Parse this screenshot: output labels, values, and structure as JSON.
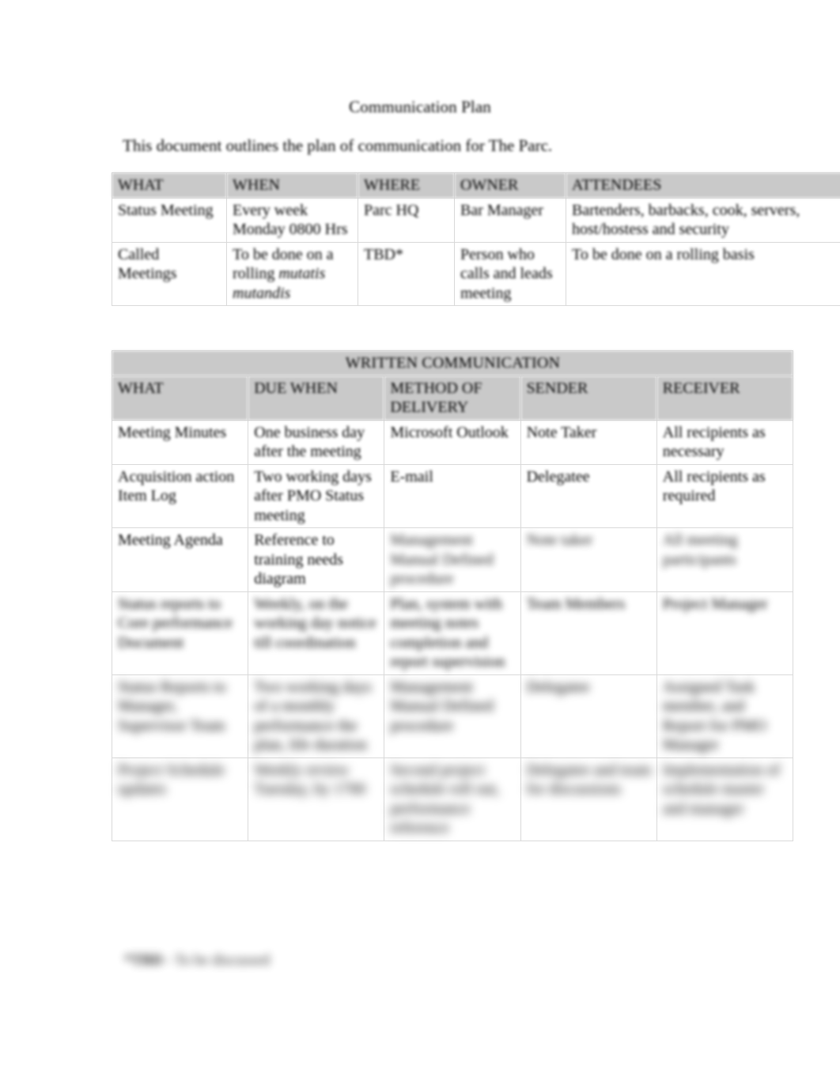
{
  "document": {
    "title": "Communication Plan",
    "intro": "This document outlines the plan of communication for The Parc.",
    "footnote_mark": "*TBD",
    "footnote_text": "- To be discussed"
  },
  "meetings_table": {
    "headers": [
      "WHAT",
      "WHEN",
      "WHERE",
      "OWNER",
      "ATTENDEES"
    ],
    "rows": [
      {
        "what": "Status Meeting",
        "when": "Every week Monday 0800 Hrs",
        "where": "Parc HQ",
        "owner": "Bar Manager",
        "attendees": "Bartenders, barbacks, cook, servers, host/hostess and security"
      },
      {
        "what": "Called Meetings",
        "when_plain": "To be done on a rolling",
        "when_italic": "mutatis mutandis",
        "where": "TBD*",
        "owner": "Person who calls and leads meeting",
        "attendees": "To be done on a rolling basis"
      }
    ]
  },
  "written_table": {
    "banner": "WRITTEN COMMUNICATION",
    "headers": [
      "WHAT",
      "DUE WHEN",
      "METHOD OF DELIVERY",
      "SENDER",
      "RECEIVER"
    ],
    "rows": [
      {
        "what": "Meeting Minutes",
        "due_when": "One business day after the meeting",
        "method": "Microsoft Outlook",
        "sender": "Note Taker",
        "receiver": "All recipients as necessary"
      },
      {
        "what": "Acquisition action Item Log",
        "due_when": "Two working days after PMO Status meeting",
        "method": "E-mail",
        "sender": "Delegatee",
        "receiver": "All recipients as required"
      },
      {
        "what": "Meeting Agenda",
        "due_when": "Reference to training needs diagram",
        "method": "Management Manual Defined procedure",
        "sender": "Note taker",
        "receiver": "All meeting participants"
      },
      {
        "what": "Status reports to Core performance Document",
        "due_when": "Weekly, on the working day notice till coordination",
        "method": "Plan, system with meeting notes completion and report supervision",
        "sender": "Team Members",
        "receiver": "Project Manager"
      },
      {
        "what": "Status Reports to Manager, Supervisor Team",
        "due_when": "Two working days of a monthly performance the plan, life duration",
        "method": "Management Manual Defined procedure",
        "sender": "Delegatee",
        "receiver": "Assigned Task member, and Report for PMO Manager"
      },
      {
        "what": "Project Schedule updates",
        "due_when": "Weekly review Tuesday, by 1700",
        "method": "Second project schedule roll out, performance reference",
        "sender": "Delegatee and team for discussions",
        "receiver": "Implementation of schedule master and manager"
      }
    ]
  }
}
